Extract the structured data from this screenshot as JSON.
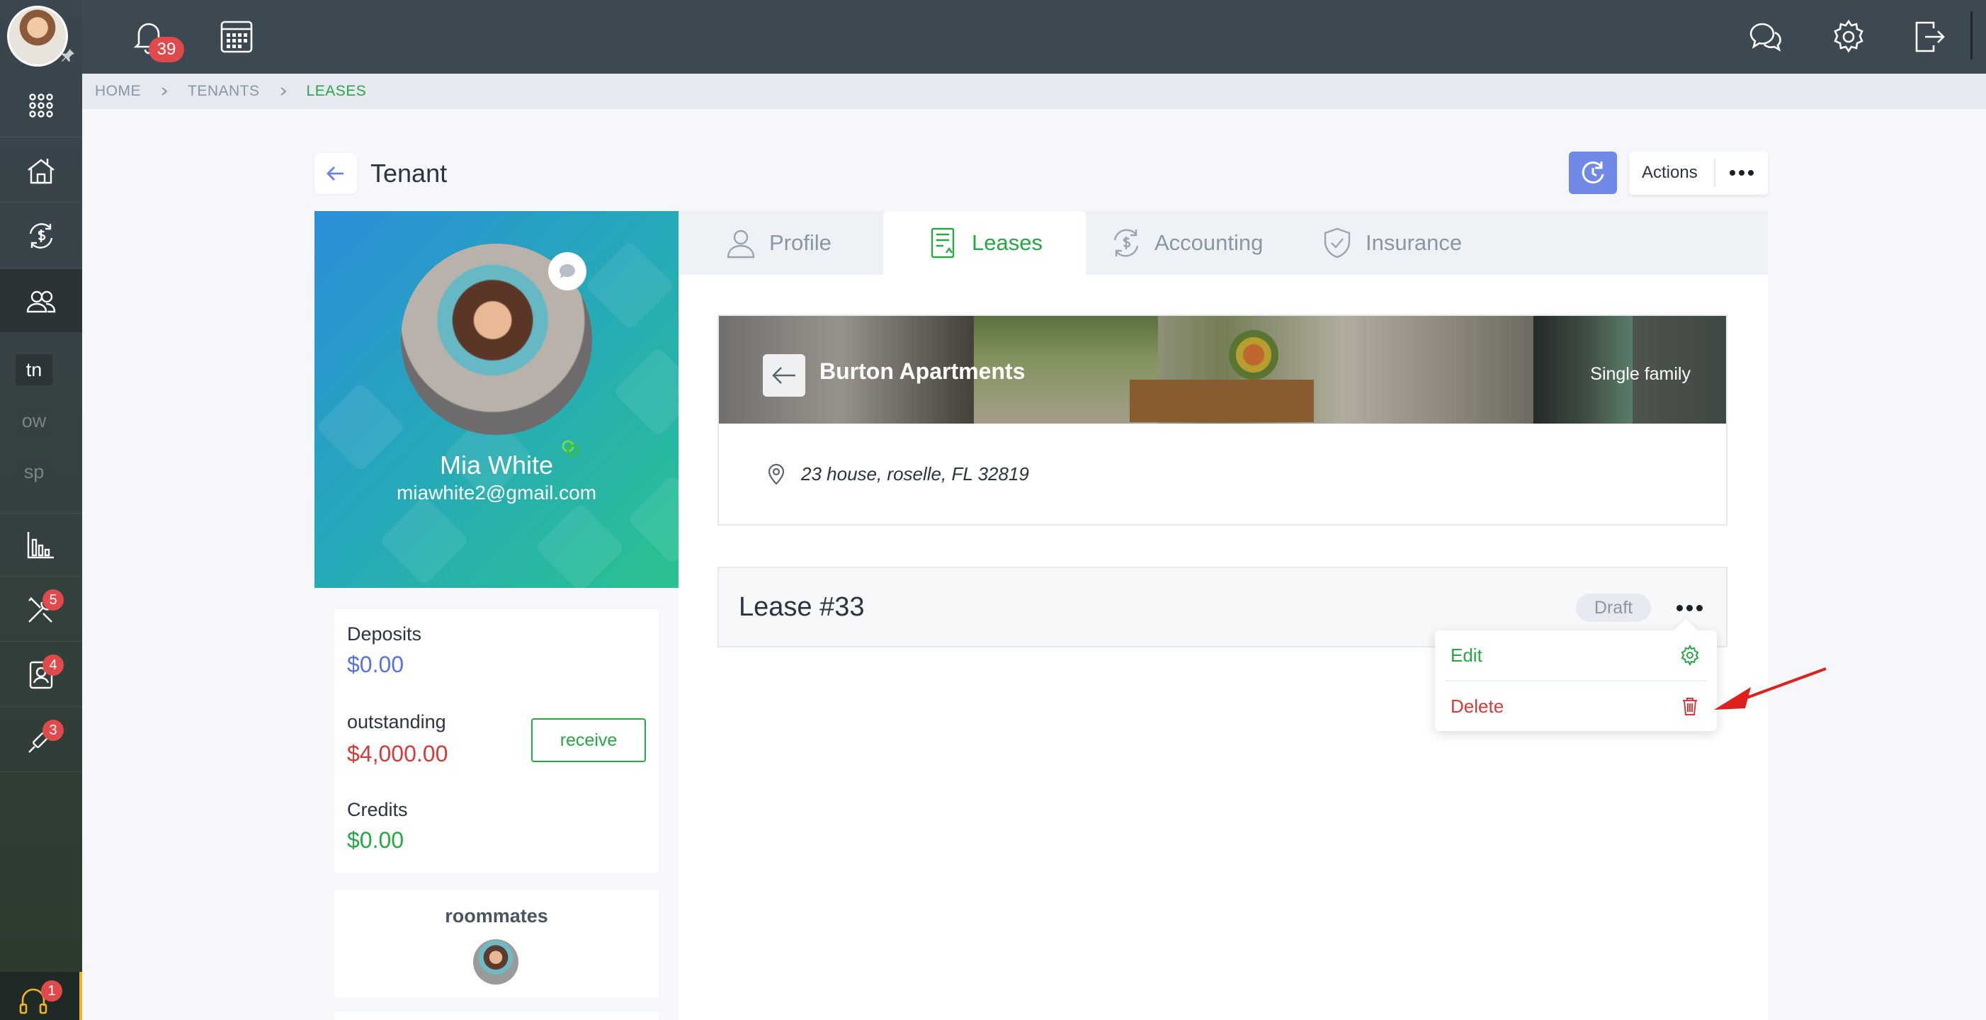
{
  "colors": {
    "accent_green": "#27a745",
    "accent_blue": "#7089e6",
    "danger_red": "#d63b3b",
    "topbar": "#3d4952"
  },
  "sidebar": {
    "items": [
      {
        "name": "apps-grid-icon"
      },
      {
        "name": "properties-icon"
      },
      {
        "name": "accounting-icon"
      },
      {
        "name": "tenants-icon",
        "active": true
      },
      {
        "name": "reports-icon"
      },
      {
        "name": "maintenance-icon",
        "badge": "5"
      },
      {
        "name": "contacts-icon",
        "badge": "4"
      },
      {
        "name": "tools-icon",
        "badge": "3"
      }
    ],
    "portals": [
      "tn",
      "ow",
      "sp"
    ],
    "support_badge": "1"
  },
  "topbar": {
    "notifications_count": "39"
  },
  "breadcrumb": [
    "HOME",
    "TENANTS",
    "LEASES"
  ],
  "header": {
    "title": "Tenant",
    "actions_label": "Actions"
  },
  "tenant": {
    "name": "Mia White",
    "email": "miawhite2@gmail.com",
    "deposits_label": "Deposits",
    "deposits_value": "$0.00",
    "outstanding_label": "outstanding",
    "outstanding_value": "$4,000.00",
    "receive_label": "receive",
    "credits_label": "Credits",
    "credits_value": "$0.00",
    "roommates_label": "roommates"
  },
  "tabs": [
    {
      "label": "Profile",
      "active": false
    },
    {
      "label": "Leases",
      "active": true
    },
    {
      "label": "Accounting",
      "active": false
    },
    {
      "label": "Insurance",
      "active": false
    }
  ],
  "property": {
    "name": "Burton Apartments",
    "type": "Single family",
    "address": "23 house, roselle, FL 32819"
  },
  "lease": {
    "title": "Lease #33",
    "status": "Draft"
  },
  "lease_menu": {
    "items": [
      {
        "label": "Edit",
        "icon": "gear-icon"
      },
      {
        "label": "Delete",
        "icon": "trash-icon"
      }
    ]
  }
}
